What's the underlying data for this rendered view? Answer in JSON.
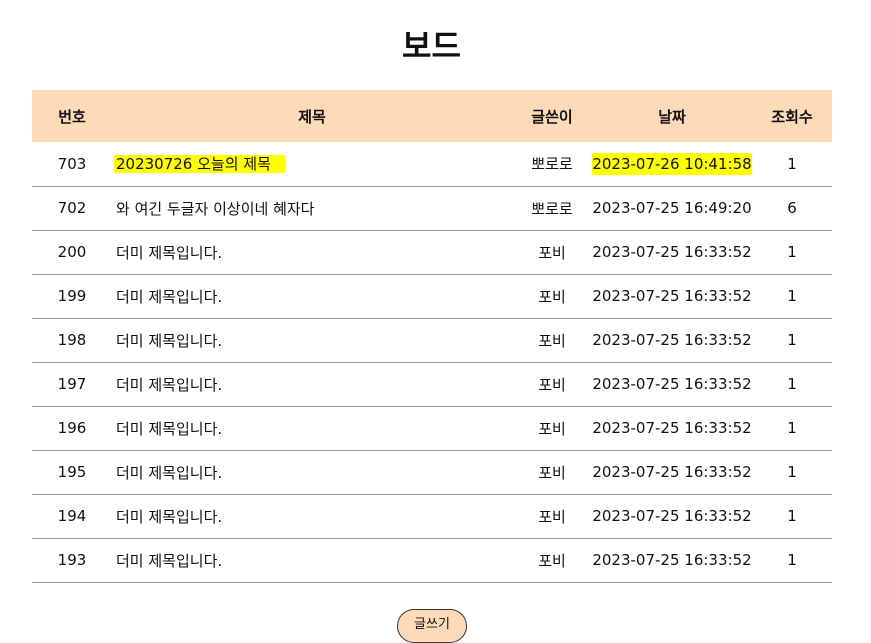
{
  "page": {
    "title": "보드"
  },
  "table": {
    "headers": {
      "number": "번호",
      "title": "제목",
      "author": "글쓴이",
      "date": "날짜",
      "views": "조회수"
    },
    "rows": [
      {
        "number": "703",
        "title": "20230726 오늘의 제목",
        "author": "뽀로로",
        "date": "2023-07-26 10:41:58",
        "views": "1",
        "highlighted": true
      },
      {
        "number": "702",
        "title": "와 여긴 두글자 이상이네 혜자다",
        "author": "뽀로로",
        "date": "2023-07-25 16:49:20",
        "views": "6",
        "highlighted": false
      },
      {
        "number": "200",
        "title": "더미 제목입니다.",
        "author": "포비",
        "date": "2023-07-25 16:33:52",
        "views": "1",
        "highlighted": false
      },
      {
        "number": "199",
        "title": "더미 제목입니다.",
        "author": "포비",
        "date": "2023-07-25 16:33:52",
        "views": "1",
        "highlighted": false
      },
      {
        "number": "198",
        "title": "더미 제목입니다.",
        "author": "포비",
        "date": "2023-07-25 16:33:52",
        "views": "1",
        "highlighted": false
      },
      {
        "number": "197",
        "title": "더미 제목입니다.",
        "author": "포비",
        "date": "2023-07-25 16:33:52",
        "views": "1",
        "highlighted": false
      },
      {
        "number": "196",
        "title": "더미 제목입니다.",
        "author": "포비",
        "date": "2023-07-25 16:33:52",
        "views": "1",
        "highlighted": false
      },
      {
        "number": "195",
        "title": "더미 제목입니다.",
        "author": "포비",
        "date": "2023-07-25 16:33:52",
        "views": "1",
        "highlighted": false
      },
      {
        "number": "194",
        "title": "더미 제목입니다.",
        "author": "포비",
        "date": "2023-07-25 16:33:52",
        "views": "1",
        "highlighted": false
      },
      {
        "number": "193",
        "title": "더미 제목입니다.",
        "author": "포비",
        "date": "2023-07-25 16:33:52",
        "views": "1",
        "highlighted": false
      }
    ]
  },
  "actions": {
    "write_label": "글쓰기"
  },
  "colors": {
    "header_background": "#ffdab9",
    "highlight": "#ffff00",
    "row_divider": "#999999"
  }
}
